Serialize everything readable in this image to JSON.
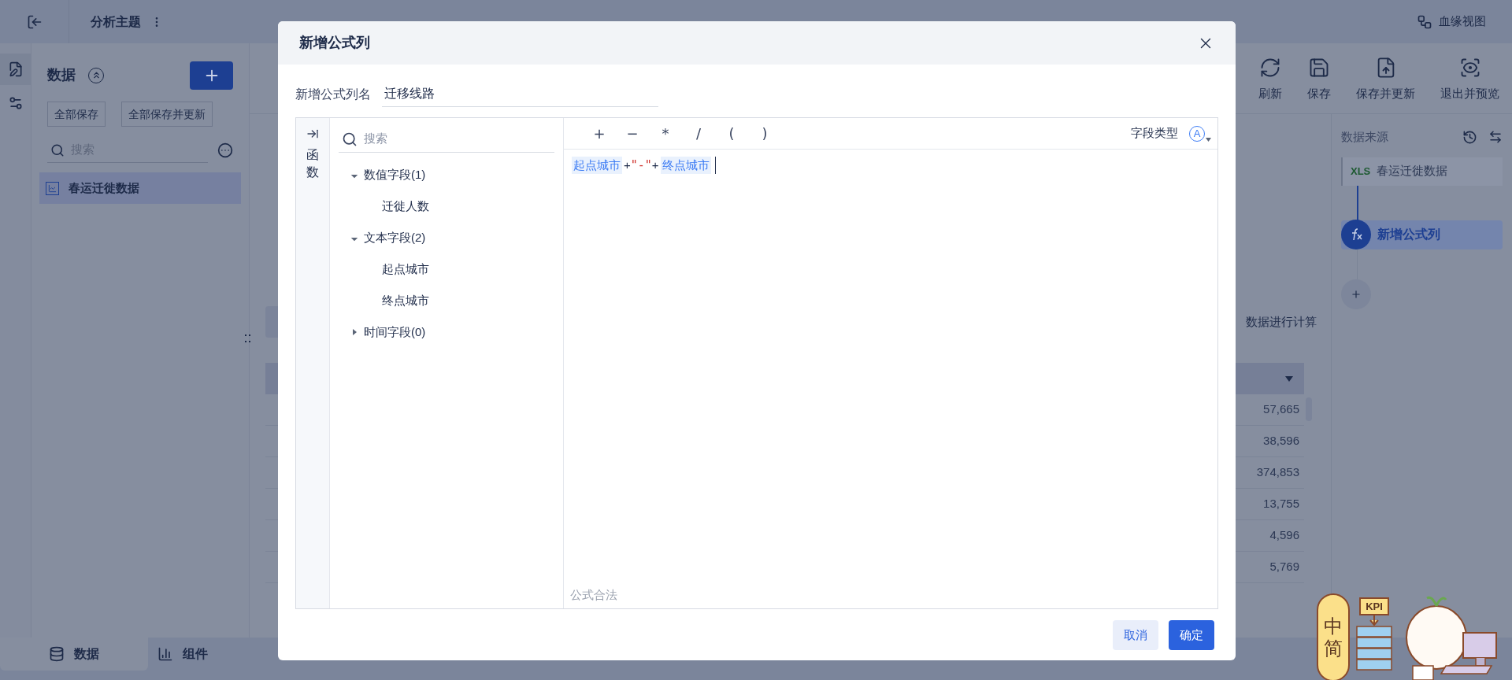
{
  "top_bar": {
    "title": "分析主题",
    "lineage_link": "血缘视图"
  },
  "data_panel": {
    "title": "数据",
    "buttons": [
      "全部保存",
      "全部保存并更新"
    ],
    "search": {
      "placeholder": "搜索"
    },
    "items": [
      {
        "label": "春运迁徙数据",
        "selected": true
      }
    ]
  },
  "toolbar": [
    {
      "label": "刷新",
      "kind": "refresh"
    },
    {
      "label": "保存",
      "kind": "save"
    },
    {
      "label": "保存并更新",
      "kind": "save_update"
    },
    {
      "label": "退出并预览",
      "kind": "preview"
    }
  ],
  "center": {
    "hint": "数据进行计算",
    "rows": [
      {
        "value": "57,665"
      },
      {
        "value": "38,596"
      },
      {
        "value": "374,853"
      },
      {
        "value": "13,755"
      },
      {
        "value": "4,596"
      },
      {
        "value": "5,769"
      }
    ]
  },
  "flow_panel": {
    "title": "数据来源",
    "steps": [
      {
        "kind": "source",
        "badge": "XLS",
        "label": "春运迁徙数据",
        "selected": false
      },
      {
        "kind": "formula",
        "label": "新增公式列",
        "selected": true
      }
    ]
  },
  "bottom_tabs": [
    {
      "label": "数据",
      "kind": "data",
      "selected": true
    },
    {
      "label": "组件",
      "kind": "widget",
      "selected": false
    }
  ],
  "dialog": {
    "title": "新增公式列",
    "name_label": "新增公式列名",
    "name_value": "迁移线路",
    "side_tab": "函数",
    "field_search": {
      "placeholder": "搜索"
    },
    "field_tree": [
      {
        "label": "数值字段(1)",
        "expanded": true,
        "children": [
          {
            "label": "迁徙人数"
          }
        ]
      },
      {
        "label": "文本字段(2)",
        "expanded": true,
        "children": [
          {
            "label": "起点城市"
          },
          {
            "label": "终点城市"
          }
        ]
      },
      {
        "label": "时间字段(0)",
        "expanded": false
      }
    ],
    "operators": [
      "+",
      "−",
      "*",
      "/",
      "(",
      ")"
    ],
    "field_type_label": "字段类型",
    "field_type": "A",
    "formula": [
      {
        "kind": "field",
        "text": "起点城市"
      },
      {
        "kind": "operator",
        "text": "+"
      },
      {
        "kind": "string",
        "text": "\"-\""
      },
      {
        "kind": "operator",
        "text": "+"
      },
      {
        "kind": "field",
        "text": "终点城市"
      }
    ],
    "status": "公式合法",
    "buttons": [
      {
        "label": "取消",
        "kind": "secondary"
      },
      {
        "label": "确定",
        "kind": "primary"
      }
    ]
  },
  "ime_widget": {
    "mode": "中",
    "script": "简",
    "sign": "KPI"
  }
}
